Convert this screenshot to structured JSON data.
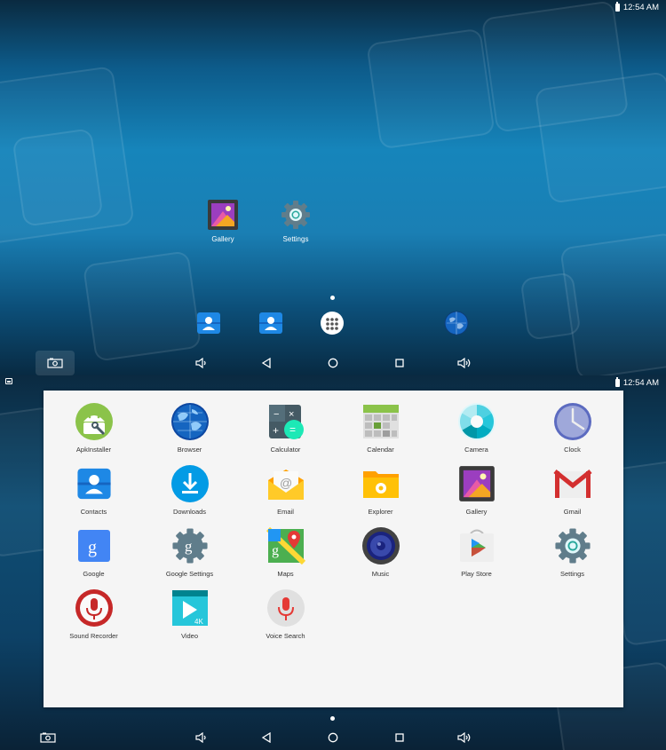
{
  "status_bar": {
    "time": "12:54 AM"
  },
  "home": {
    "desktop_icons": [
      {
        "label": "Gallery",
        "icon": "gallery-icon"
      },
      {
        "label": "Settings",
        "icon": "settings-gear-icon"
      }
    ],
    "dock": [
      {
        "icon": "contacts-icon"
      },
      {
        "icon": "contacts-icon"
      },
      {
        "icon": "all-apps-icon"
      },
      {
        "icon": "browser-globe-icon"
      }
    ],
    "page_indicator": {
      "pages": 1,
      "current": 1
    }
  },
  "drawer": {
    "apps": [
      {
        "label": "ApkInstaller",
        "icon": "android-icon"
      },
      {
        "label": "Browser",
        "icon": "globe-icon"
      },
      {
        "label": "Calculator",
        "icon": "calculator-icon"
      },
      {
        "label": "Calendar",
        "icon": "calendar-icon"
      },
      {
        "label": "Camera",
        "icon": "camera-shutter-icon"
      },
      {
        "label": "Clock",
        "icon": "clock-icon"
      },
      {
        "label": "Contacts",
        "icon": "contacts-icon"
      },
      {
        "label": "Downloads",
        "icon": "download-icon"
      },
      {
        "label": "Email",
        "icon": "email-icon"
      },
      {
        "label": "Explorer",
        "icon": "folder-icon"
      },
      {
        "label": "Gallery",
        "icon": "gallery-icon"
      },
      {
        "label": "Gmail",
        "icon": "gmail-icon"
      },
      {
        "label": "Google",
        "icon": "google-icon"
      },
      {
        "label": "Google Settings",
        "icon": "google-settings-icon"
      },
      {
        "label": "Maps",
        "icon": "maps-icon"
      },
      {
        "label": "Music",
        "icon": "speaker-icon"
      },
      {
        "label": "Play Store",
        "icon": "play-store-icon"
      },
      {
        "label": "Settings",
        "icon": "settings-gear-icon"
      },
      {
        "label": "Sound Recorder",
        "icon": "microphone-icon"
      },
      {
        "label": "Video",
        "icon": "video-icon"
      },
      {
        "label": "Voice Search",
        "icon": "voice-search-icon"
      }
    ]
  },
  "navbar": {
    "buttons": [
      {
        "icon": "screenshot-icon"
      },
      {
        "icon": "volume-down-icon"
      },
      {
        "icon": "back-icon"
      },
      {
        "icon": "home-icon"
      },
      {
        "icon": "recents-icon"
      },
      {
        "icon": "volume-up-icon"
      }
    ]
  },
  "colors": {
    "wallpaper_top": "#0d5b8a",
    "wallpaper_mid": "#1685bb",
    "drawer_bg": "#f5f5f5",
    "label_text": "#333333"
  }
}
